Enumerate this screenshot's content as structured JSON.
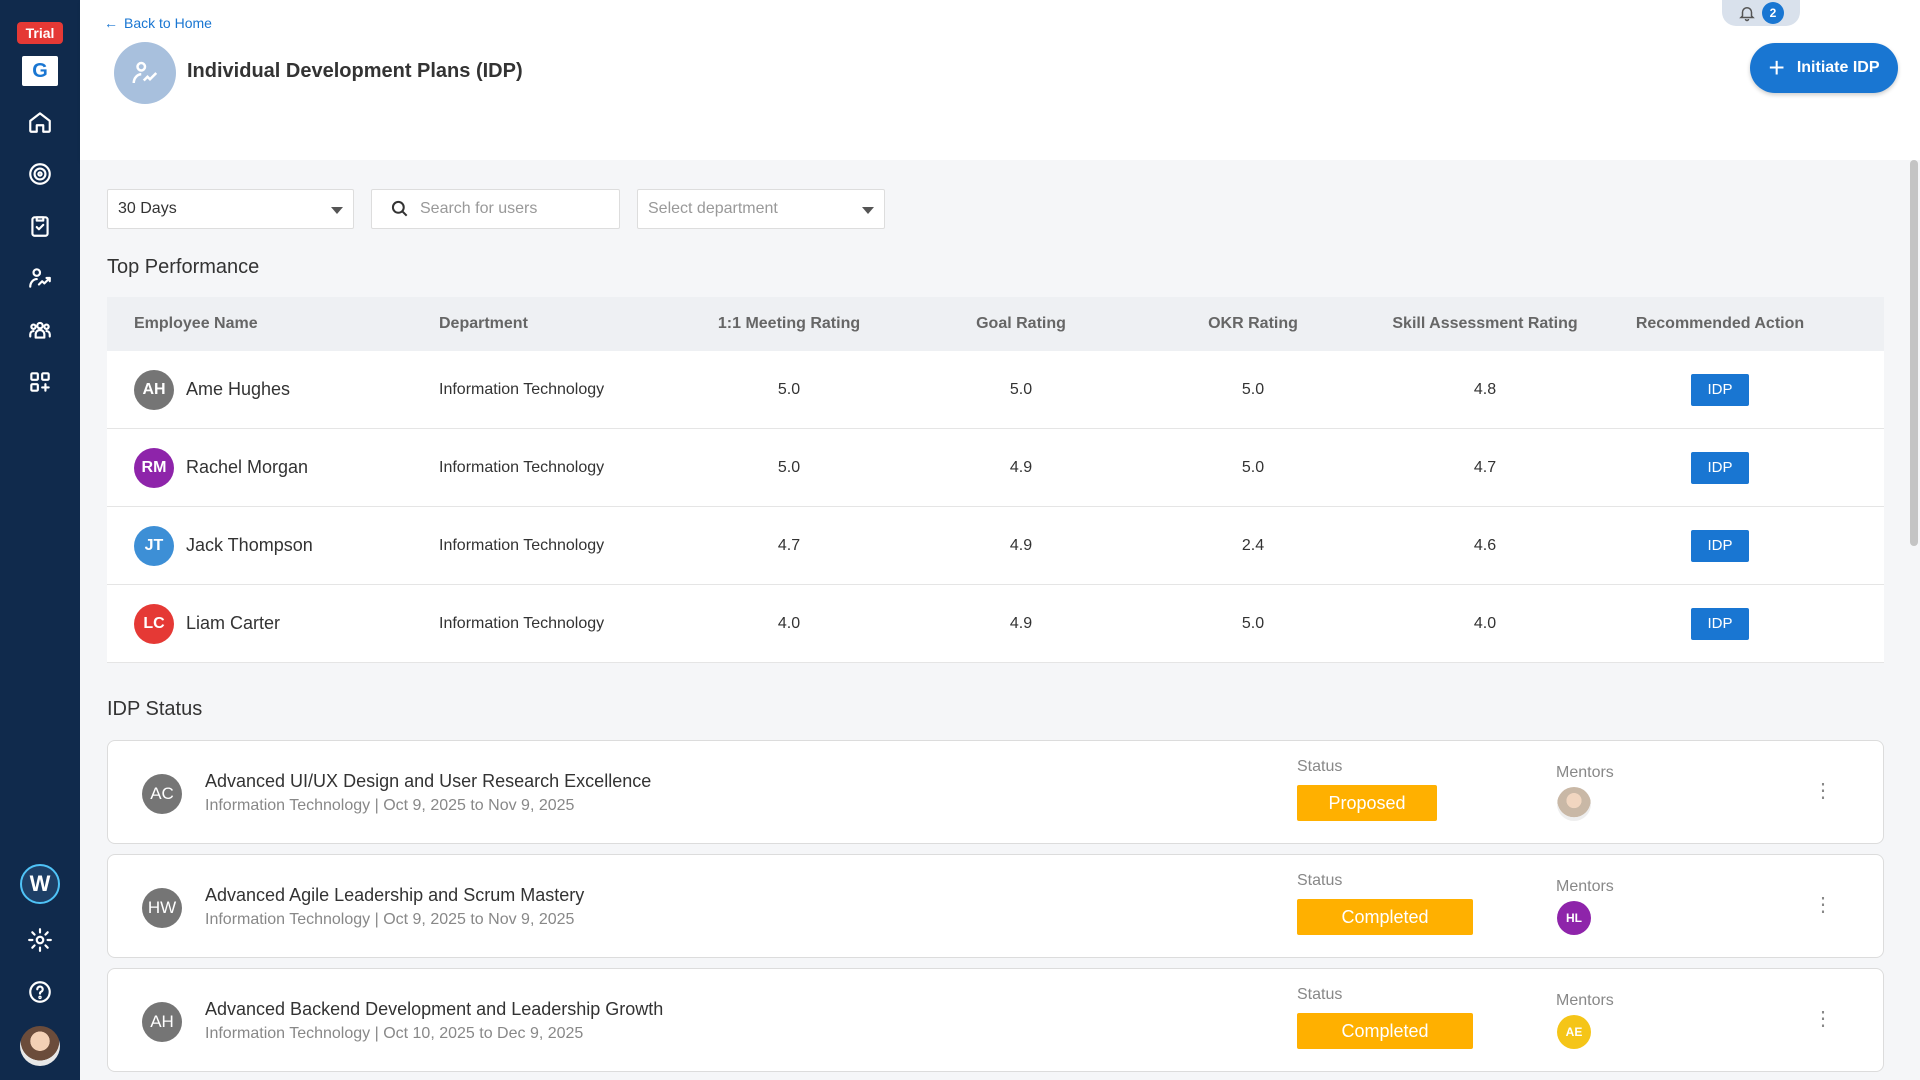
{
  "sidebar": {
    "trial_label": "Trial",
    "logo_letter": "G",
    "w_logo_letter": "W",
    "items": [
      "home-icon",
      "target-icon",
      "clipboard-check-icon",
      "idp-icon",
      "team-icon",
      "apps-icon"
    ],
    "bottom_items": [
      "settings-icon",
      "help-icon"
    ]
  },
  "header": {
    "back_label": "Back to Home",
    "title": "Individual Development Plans (IDP)",
    "notification_count": "2",
    "initiate_label": "Initiate IDP",
    "accent_color": "#1976d2"
  },
  "filters": {
    "period_value": "30 Days",
    "search_placeholder": "Search for users",
    "department_placeholder": "Select department"
  },
  "top_performance": {
    "title": "Top Performance",
    "columns": [
      "Employee Name",
      "Department",
      "1:1 Meeting Rating",
      "Goal Rating",
      "OKR Rating",
      "Skill Assessment Rating",
      "Recommended Action"
    ],
    "rows": [
      {
        "initials": "AH",
        "name": "Ame Hughes",
        "department": "Information Technology",
        "meeting": "5.0",
        "goal": "5.0",
        "okr": "5.0",
        "skill": "4.8",
        "action": "IDP",
        "color": "#757575"
      },
      {
        "initials": "RM",
        "name": "Rachel Morgan",
        "department": "Information Technology",
        "meeting": "5.0",
        "goal": "4.9",
        "okr": "5.0",
        "skill": "4.7",
        "action": "IDP",
        "color": "#8e24aa"
      },
      {
        "initials": "JT",
        "name": "Jack Thompson",
        "department": "Information Technology",
        "meeting": "4.7",
        "goal": "4.9",
        "okr": "2.4",
        "skill": "4.6",
        "action": "IDP",
        "color": "#3d8fd6"
      },
      {
        "initials": "LC",
        "name": "Liam Carter",
        "department": "Information Technology",
        "meeting": "4.0",
        "goal": "4.9",
        "okr": "5.0",
        "skill": "4.0",
        "action": "IDP",
        "color": "#e53935"
      }
    ]
  },
  "idp_status": {
    "title": "IDP Status",
    "status_label": "Status",
    "mentors_label": "Mentors",
    "cards": [
      {
        "initials": "AC",
        "title": "Advanced UI/UX Design and User Research Excellence",
        "subtitle": "Information Technology | Oct 9, 2025 to Nov 9, 2025",
        "status": "Proposed",
        "mentor_initials": "",
        "mentor_color": "#c9b8a6"
      },
      {
        "initials": "HW",
        "title": "Advanced Agile Leadership and Scrum Mastery",
        "subtitle": "Information Technology | Oct 9, 2025 to Nov 9, 2025",
        "status": "Completed",
        "mentor_initials": "HL",
        "mentor_color": "#8e24aa"
      },
      {
        "initials": "AH",
        "title": "Advanced Backend Development and Leadership Growth",
        "subtitle": "Information Technology | Oct 10, 2025 to Dec 9, 2025",
        "status": "Completed",
        "mentor_initials": "AE",
        "mentor_color": "#f5c518"
      }
    ]
  }
}
